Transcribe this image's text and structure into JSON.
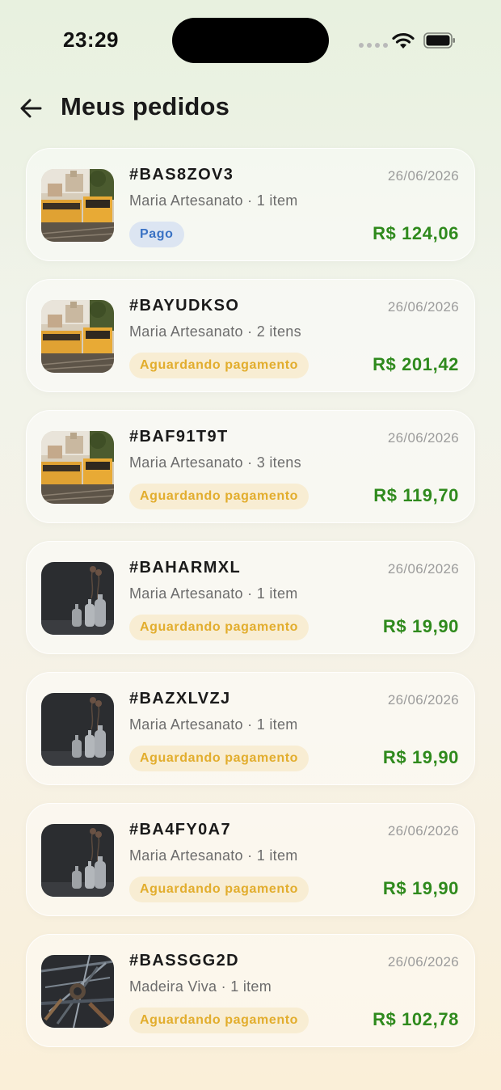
{
  "status_bar": {
    "time": "23:29"
  },
  "header": {
    "title": "Meus pedidos"
  },
  "colors": {
    "accent_green": "#2f8a1d",
    "paid_badge_text": "#3a72c4",
    "paid_badge_bg": "#dce5f2",
    "pending_badge_text": "#e2ad2d",
    "pending_badge_bg": "#f8edd3"
  },
  "orders": [
    {
      "code": "#BAS8ZOV3",
      "date": "26/06/2026",
      "meta": "Maria Artesanato · 1 item",
      "status": "Pago",
      "status_type": "paid",
      "total": "R$ 124,06",
      "image": "tram-photo"
    },
    {
      "code": "#BAYUDKSO",
      "date": "26/06/2026",
      "meta": "Maria Artesanato · 2 itens",
      "status": "Aguardando pagamento",
      "status_type": "pending",
      "total": "R$ 201,42",
      "image": "tram-photo"
    },
    {
      "code": "#BAF91T9T",
      "date": "26/06/2026",
      "meta": "Maria Artesanato · 3 itens",
      "status": "Aguardando pagamento",
      "status_type": "pending",
      "total": "R$ 119,70",
      "image": "tram-photo"
    },
    {
      "code": "#BAHARMXL",
      "date": "26/06/2026",
      "meta": "Maria Artesanato · 1 item",
      "status": "Aguardando pagamento",
      "status_type": "pending",
      "total": "R$ 19,90",
      "image": "vases-photo"
    },
    {
      "code": "#BAZXLVZJ",
      "date": "26/06/2026",
      "meta": "Maria Artesanato · 1 item",
      "status": "Aguardando pagamento",
      "status_type": "pending",
      "total": "R$ 19,90",
      "image": "vases-photo"
    },
    {
      "code": "#BA4FY0A7",
      "date": "26/06/2026",
      "meta": "Maria Artesanato · 1 item",
      "status": "Aguardando pagamento",
      "status_type": "pending",
      "total": "R$ 19,90",
      "image": "vases-photo"
    },
    {
      "code": "#BASSGG2D",
      "date": "26/06/2026",
      "meta": "Madeira Viva · 1 item",
      "status": "Aguardando pagamento",
      "status_type": "pending",
      "total": "R$ 102,78",
      "image": "tools-photo"
    }
  ]
}
